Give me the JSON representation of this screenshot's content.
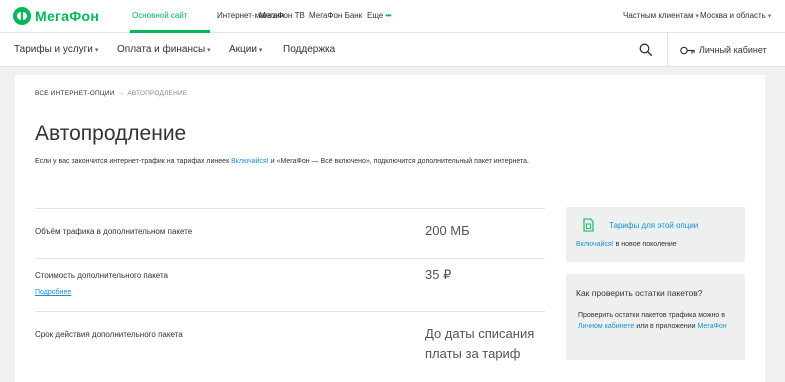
{
  "brand": {
    "name": "МегаФон",
    "color": "#00b956"
  },
  "topbar": {
    "links": [
      "Основной сайт",
      "Интернет-магазин",
      "МегаФон ТВ",
      "МегаФон Банк",
      "Еще"
    ],
    "more_dots": "•••",
    "client_type": "Частным клиентам",
    "region": "Москва и область"
  },
  "mainnav": {
    "items": [
      "Тарифы и услуги",
      "Оплата и финансы",
      "Акции",
      "Поддержка"
    ],
    "search_icon": "search-icon",
    "cabinet_label": "Личный кабинет"
  },
  "breadcrumb": {
    "parent": "ВСЕ ИНТЕРНЕТ-ОПЦИИ",
    "arrow": "→",
    "current": "АВТОПРОДЛЕНИЕ"
  },
  "page": {
    "title": "Автопродление",
    "intro_before": "Если у вас закончится интернет-трафик на тарифах линеек ",
    "intro_link": "Включайся!",
    "intro_after": " и «МегаФон — Всё включено», подключится дополнительный пакет интернета."
  },
  "params": [
    {
      "label": "Объём трафика в дополнительном пакете",
      "value": "200 МБ"
    },
    {
      "label": "Стоимость дополнительного пакета",
      "value": "35 ₽",
      "more": "Подробнее"
    },
    {
      "label": "Срок действия дополнительного пакета",
      "value": "До даты списания платы за тариф"
    }
  ],
  "side": {
    "tariffs_link": "Тарифы для этой опции",
    "tariffs_sub_link": "Включайся!",
    "tariffs_sub_text": " в новое поколение",
    "check_title": "Как проверить остатки пакетов?",
    "check_text_1": "Проверить остатки пакетов трафика можно в ",
    "check_link_1": "Личном кабинете",
    "check_text_2": " или в приложении ",
    "check_link_2": "МегаФон"
  }
}
